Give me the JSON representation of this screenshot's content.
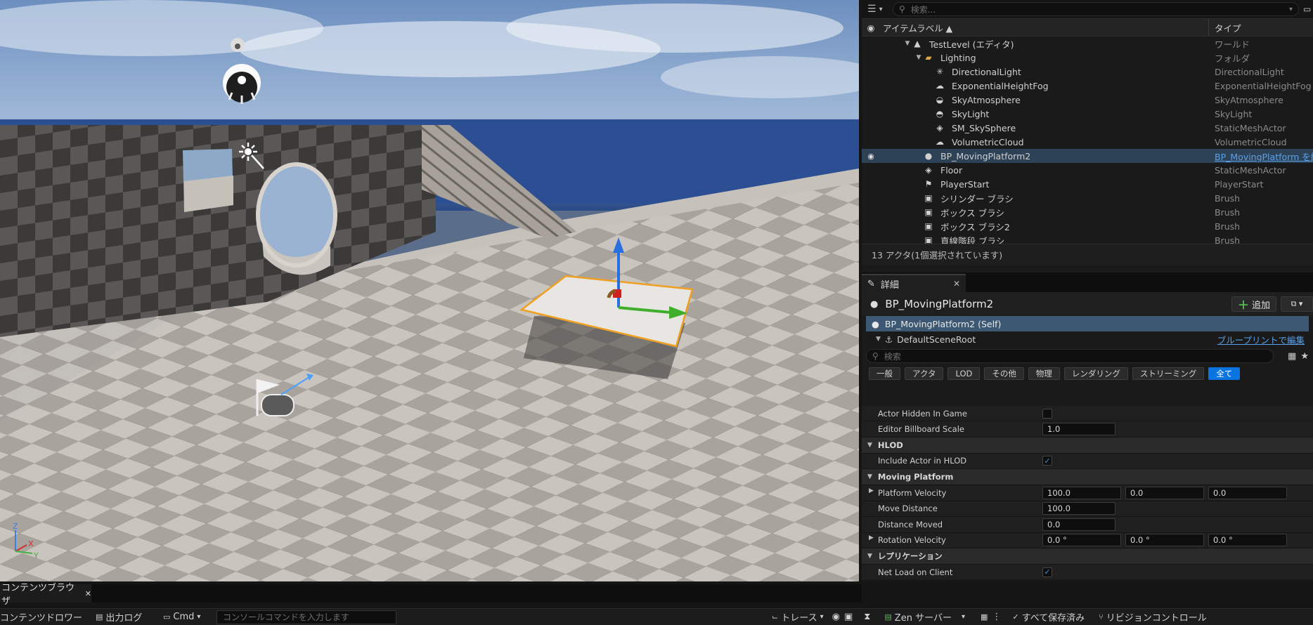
{
  "outliner": {
    "search_placeholder": "検索...",
    "columns": {
      "label": "アイテムラベル ▲",
      "type": "タイプ"
    },
    "rows": [
      {
        "name": "TestLevel (エディタ)",
        "type": "ワールド",
        "icon": "level-icon",
        "glyph": "▲",
        "tw": "▼"
      },
      {
        "name": "Lighting",
        "type": "フォルダ",
        "icon": "folder-icon",
        "glyph": "▰",
        "tw": "▼"
      },
      {
        "name": "DirectionalLight",
        "type": "DirectionalLight",
        "icon": "directional-light-icon",
        "glyph": "✳",
        "tw": ""
      },
      {
        "name": "ExponentialHeightFog",
        "type": "ExponentialHeightFog",
        "icon": "fog-icon",
        "glyph": "☁",
        "tw": ""
      },
      {
        "name": "SkyAtmosphere",
        "type": "SkyAtmosphere",
        "icon": "sky-atmosphere-icon",
        "glyph": "◒",
        "tw": ""
      },
      {
        "name": "SkyLight",
        "type": "SkyLight",
        "icon": "sky-light-icon",
        "glyph": "◓",
        "tw": ""
      },
      {
        "name": "SM_SkySphere",
        "type": "StaticMeshActor",
        "icon": "static-mesh-icon",
        "glyph": "◈",
        "tw": ""
      },
      {
        "name": "VolumetricCloud",
        "type": "VolumetricCloud",
        "icon": "cloud-icon",
        "glyph": "☁",
        "tw": ""
      },
      {
        "name": "BP_MovingPlatform2",
        "type": "BP_MovingPlatform を編集",
        "icon": "blueprint-actor-icon",
        "glyph": "●",
        "tw": ""
      },
      {
        "name": "Floor",
        "type": "StaticMeshActor",
        "icon": "static-mesh-icon",
        "glyph": "◈",
        "tw": ""
      },
      {
        "name": "PlayerStart",
        "type": "PlayerStart",
        "icon": "player-start-icon",
        "glyph": "⚑",
        "tw": ""
      },
      {
        "name": "シリンダー ブラシ",
        "type": "Brush",
        "icon": "brush-icon",
        "glyph": "▣",
        "tw": ""
      },
      {
        "name": "ボックス ブラシ",
        "type": "Brush",
        "icon": "brush-icon",
        "glyph": "▣",
        "tw": ""
      },
      {
        "name": "ボックス ブラシ2",
        "type": "Brush",
        "icon": "brush-icon",
        "glyph": "▣",
        "tw": ""
      },
      {
        "name": "直線階段 ブラシ",
        "type": "Brush",
        "icon": "brush-icon",
        "glyph": "▣",
        "tw": ""
      }
    ],
    "footer": "13 アクタ(1個選択されています)"
  },
  "details": {
    "tab": "詳細",
    "actor_name": "BP_MovingPlatform2",
    "add_label": "追加",
    "self_label": "BP_MovingPlatform2 (Self)",
    "root_label": "DefaultSceneRoot",
    "root_link": "ブループリントで編集",
    "search_placeholder": "検索",
    "filters": [
      "一般",
      "アクタ",
      "LOD",
      "その他",
      "物理",
      "レンダリング",
      "ストリーミング",
      "全て"
    ],
    "active_filter": "全て",
    "props": {
      "actor_hidden": "Actor Hidden In Game",
      "billboard": "Editor Billboard Scale",
      "billboard_val": "1.0",
      "hlod_cat": "HLOD",
      "include_hlod": "Include Actor in HLOD",
      "moving_cat": "Moving Platform",
      "platform_velocity": "Platform Velocity",
      "pv": [
        "100.0",
        "0.0",
        "0.0"
      ],
      "move_distance": "Move Distance",
      "move_distance_val": "100.0",
      "distance_moved": "Distance Moved",
      "distance_moved_val": "0.0",
      "rotation_velocity": "Rotation Velocity",
      "rv": [
        "0.0 °",
        "0.0 °",
        "0.0 °"
      ],
      "replication_cat": "レプリケーション",
      "net_load": "Net Load on Client"
    }
  },
  "bottom": {
    "cb_tab": "コンテンツブラウザ",
    "drawer": "コンテンツドロワー",
    "output_log": "出力ログ",
    "cmd": "Cmd",
    "cmd_placeholder": "コンソールコマンドを入力します",
    "trace": "トレース",
    "zen": "Zen サーバー",
    "saved": "すべて保存済み",
    "revision": "リビジョンコントロール"
  },
  "viewport": {
    "axis_labels": [
      "Z",
      "X",
      "Y"
    ]
  },
  "colors": {
    "selection": "#2e4257",
    "accent_blue": "#0a74e0",
    "link": "#5aa0e6",
    "gizmo_z": "#2a6fe0",
    "gizmo_y": "#3fae2a",
    "gizmo_x": "#d02020",
    "platform_outline": "#f0a020"
  }
}
